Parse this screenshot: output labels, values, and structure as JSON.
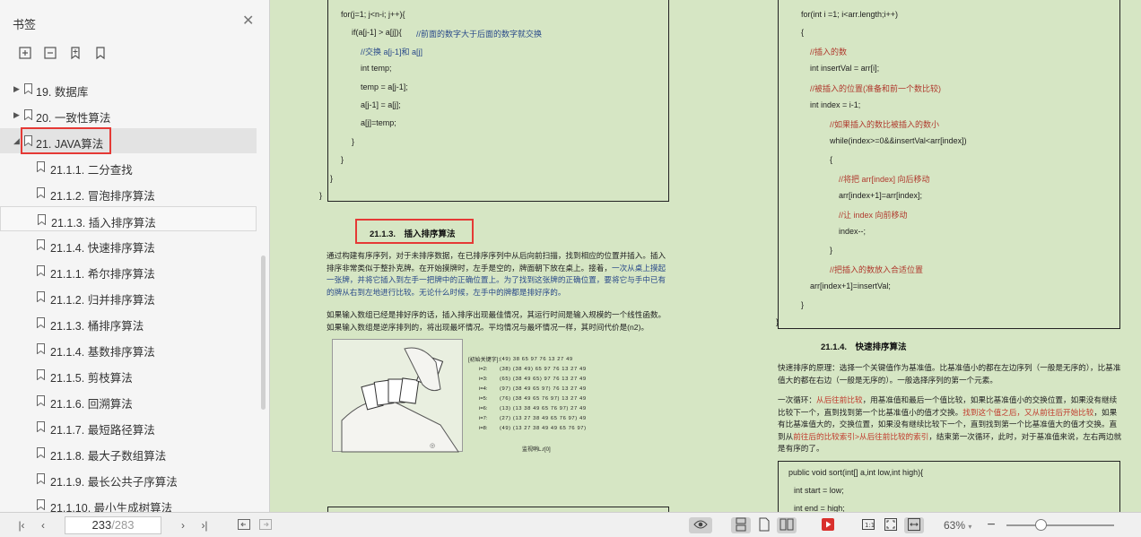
{
  "sidebar": {
    "title": "书签",
    "close_icon": "close-icon",
    "tools": [
      "expand-all-icon",
      "collapse-all-icon",
      "add-bookmark-icon",
      "bookmark-icon"
    ],
    "items": [
      {
        "label": "19. 数据库"
      },
      {
        "label": "20. 一致性算法"
      },
      {
        "label": "21. JAVA算法"
      },
      {
        "label": "21.1.1. 二分查找"
      },
      {
        "label": "21.1.2. 冒泡排序算法"
      },
      {
        "label": "21.1.3. 插入排序算法"
      },
      {
        "label": "21.1.4. 快速排序算法"
      },
      {
        "label": "21.1.1. 希尔排序算法"
      },
      {
        "label": "21.1.2. 归并排序算法"
      },
      {
        "label": "21.1.3. 桶排序算法"
      },
      {
        "label": "21.1.4. 基数排序算法"
      },
      {
        "label": "21.1.5. 剪枝算法"
      },
      {
        "label": "21.1.6. 回溯算法"
      },
      {
        "label": "21.1.7. 最短路径算法"
      },
      {
        "label": "21.1.8. 最大子数组算法"
      },
      {
        "label": "21.1.9. 最长公共子序算法"
      },
      {
        "label": "21.1.10. 最小生成树算法"
      }
    ]
  },
  "left_page": {
    "code": [
      "for(j=1; j<n-i; j++){",
      "if(a[j-1] > a[j]){",
      "//前面的数字大于后面的数字就交换",
      "//交换 a[j-1]和 a[j]",
      "int temp;",
      "temp = a[j-1];",
      "a[j-1] = a[j];",
      "a[j]=temp;",
      "}",
      "}",
      "}",
      "}"
    ],
    "section_title": "21.1.3.　插入排序算法",
    "para1_a": "通过构建有序序列，对于未排序数据，在已排序序列中从后向前扫描，找到相应的位置并插入。插入排序非常类似于整扑克牌。在开始摸牌时，左手是空的，牌面朝下放在桌上。接着，",
    "para1_b": "一次从桌上摸起一张牌，并将它插入到左手一把牌中的正确位置上。为了找到这张牌的正确位置，要将它与手中已有的牌从右到左地进行比较。无论什么时候，左手中的牌都是排好序的。",
    "para2": "如果输入数组已经是排好序的话，插入排序出现最佳情况，其运行时间是输入规模的一个线性函数。如果输入数组是逆序排列的，将出现最坏情况。平均情况与最坏情况一样，其时间代价是(n2)。",
    "table_header": "[初始关键字]:",
    "table_rows": [
      {
        "k": "",
        "v": "(49)  38  65  97  76  13  27  49"
      },
      {
        "k": "i=2:",
        "v": "(38)  (38  49)  65  97  76  13  27  49"
      },
      {
        "k": "i=3:",
        "v": "(65)  (38  49  65)  97  76  13  27  49"
      },
      {
        "k": "i=4:",
        "v": "(97)  (38  49  65  97)  76  13  27  49"
      },
      {
        "k": "i=5:",
        "v": "(76)  (38  49  65  76  97)  13  27  49"
      },
      {
        "k": "i=6:",
        "v": "(13)  (13  38  49  65  76  97)  27  49"
      },
      {
        "k": "i=7:",
        "v": "(27)  (13  27  38  49  65  76  97)  49"
      },
      {
        "k": "i=8:",
        "v": "(49)  (13  27  38  49  49  65  76  97)"
      }
    ],
    "table_footer": "监视哨L.r[0]"
  },
  "right_page": {
    "code": [
      "for(int i =1; i<arr.length;i++)",
      "{",
      "//插入的数",
      "int insertVal = arr[i];",
      "//被插入的位置(准备和前一个数比较)",
      "int index = i-1;",
      "//如果插入的数比被插入的数小",
      "while(index>=0&&insertVal<arr[index])",
      "{",
      "//将把 arr[index] 向后移动",
      "arr[index+1]=arr[index];",
      "//让 index 向前移动",
      "index--;",
      "}",
      "//把插入的数放入合适位置",
      "arr[index+1]=insertVal;",
      "}",
      "}"
    ],
    "section_title": "21.1.4.　快速排序算法",
    "para1": "快速排序的原理：选择一个关键值作为基准值。比基准值小的都在左边序列（一般是无序的），比基准值大的都在右边（一般是无序的）。一般选择序列的第一个元素。",
    "para2_a": "一次循环：",
    "para2_b": "从后往前比较",
    "para2_c": "，用基准值和最后一个值比较，如果比基准值小的交换位置，如果没有继续比较下一个，直到找到第一个比基准值小的值才交换。",
    "para2_d": "找到这个值之后，又从前往后开始比较",
    "para2_e": "，如果有比基准值大的，交换位置，如果没有继续比较下一个，直到找到第一个比基准值大的值才交换。直到从",
    "para2_f": "前往后的比较索引>从后往前比较的索引",
    "para2_g": "，结束第一次循环，此时，对于基准值来说，左右两边就是有序的了。",
    "code2": [
      "public void sort(int[] a,int low,int high){",
      "int start = low;",
      "int end = high;"
    ]
  },
  "bottombar": {
    "page_current": "233",
    "page_total": "/283",
    "zoom": "63%",
    "zoom_level": 0.32
  }
}
